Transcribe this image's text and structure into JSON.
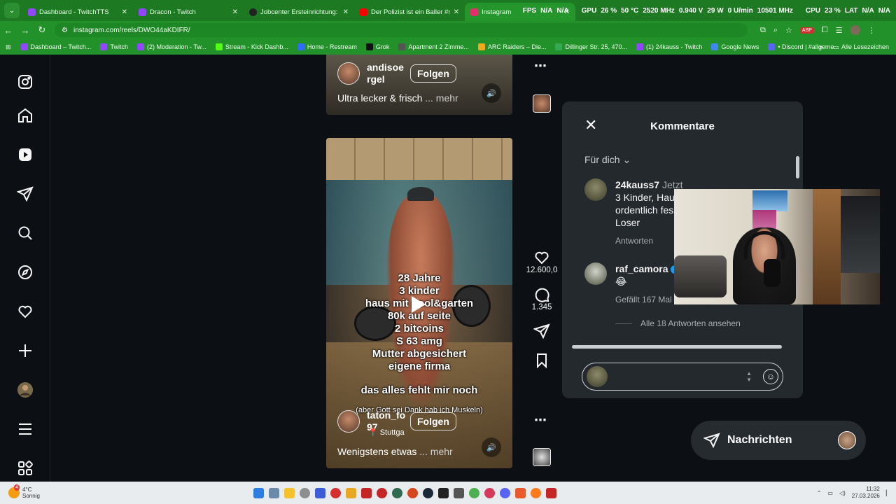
{
  "browser": {
    "tabs": [
      {
        "title": "Dashboard - TwitchTTS",
        "color": "#9146ff",
        "active": false
      },
      {
        "title": "Dracon - Twitch",
        "color": "#9146ff",
        "active": false
      },
      {
        "title": "Jobcenter Ersteinrichtung: Betr",
        "color": "#222222",
        "active": false
      },
      {
        "title": "Der Polizist ist ein Baller #mois",
        "color": "#ff0000",
        "active": false
      },
      {
        "title": "Instagram",
        "color": "#e1306c",
        "active": true
      }
    ],
    "hud": {
      "fps": "FPS",
      "fps_val": "N/A",
      "fps_val2": "N/A",
      "gpu": "GPU",
      "gpu_val": "26 %",
      "gpu_temp": "50 °C",
      "gpu_mhz": "2520 MHz",
      "gpu_v": "0.940 V",
      "gpu_w": "29 W",
      "gpu_rpm": "0 U/min",
      "gpu_mem": "10501 MHz",
      "cpu": "CPU",
      "cpu_val": "23 %",
      "lat": "LAT",
      "lat_val": "N/A",
      "lat_val2": "N/A"
    },
    "url": "instagram.com/reels/DWO44aKDIFR/",
    "bookmarks": [
      {
        "label": "Dashboard – Twitch...",
        "color": "#9146ff"
      },
      {
        "label": "Twitch",
        "color": "#9146ff"
      },
      {
        "label": "(2) Moderation - Tw...",
        "color": "#9146ff"
      },
      {
        "label": "Stream - Kick Dashb...",
        "color": "#53fc18"
      },
      {
        "label": "Home - Restream",
        "color": "#2f6bff"
      },
      {
        "label": "Grok",
        "color": "#111111"
      },
      {
        "label": "Apartment 2 Zimme...",
        "color": "#555555"
      },
      {
        "label": "ARC Raiders – Die...",
        "color": "#f2a81d"
      },
      {
        "label": "Dillinger Str. 25, 470...",
        "color": "#34a853"
      },
      {
        "label": "(1) 24kauss - Twitch",
        "color": "#9146ff"
      },
      {
        "label": "Google News",
        "color": "#4285f4"
      },
      {
        "label": "• Discord | #allgeme...",
        "color": "#5865f2"
      }
    ],
    "bookmarks_more": "»",
    "all_bookmarks": "Alle Lesezeichen"
  },
  "reel_top": {
    "username": "andisoe rgel",
    "follow": "Folgen",
    "caption": "Ultra lecker & frisch",
    "more": "... mehr"
  },
  "reel_main": {
    "overlay_lines": [
      "28 Jahre",
      "3 kinder",
      "haus mit pool&garten",
      "80k auf seite",
      "2 bitcoins",
      "S 63 amg",
      "Mutter abgesichert",
      "eigene firma"
    ],
    "overlay_tail": "das alles fehlt mir noch",
    "overlay_small": "(aber Gott sei Dank hab ich Muskeln)",
    "username": "taton_fo 97",
    "follow": "Folgen",
    "location": "Stuttga",
    "caption": "Wenigstens etwas",
    "more": "... mehr"
  },
  "actions": {
    "likes": "12.600,0",
    "comments": "1.345"
  },
  "comments_panel": {
    "title": "Kommentare",
    "filter": "Für dich",
    "items": [
      {
        "user": "24kauss7",
        "time": "Jetzt",
        "text_lines": [
          "3 Kinder, Hau",
          "ordentlich fes",
          "Loser"
        ],
        "meta": "Antworten"
      },
      {
        "user": "raf_camora",
        "time": "",
        "text_lines": [
          "😂"
        ],
        "meta": "Gefällt 167 Mal"
      }
    ],
    "replies": "Alle 18 Antworten ansehen",
    "input_placeholder": ""
  },
  "messages": {
    "label": "Nachrichten"
  },
  "taskbar": {
    "temp": "4°C",
    "weather": "Sonnig",
    "notif": "4",
    "time": "11:32",
    "date": "27.03.2026"
  }
}
